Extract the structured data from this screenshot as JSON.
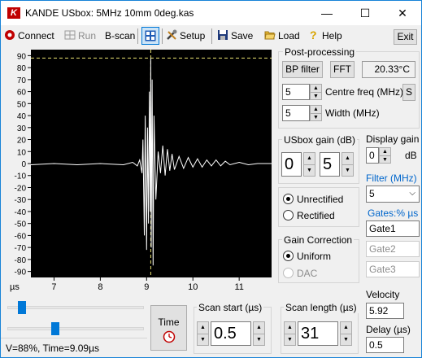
{
  "window": {
    "app_icon": "K",
    "title": "KANDE USbox: 5MHz 10mm 0deg.kas",
    "minimize": "—",
    "maximize": "☐",
    "close": "✕"
  },
  "toolbar": {
    "connect": "Connect",
    "run": "Run",
    "bscan": "B-scan",
    "setup": "Setup",
    "save": "Save",
    "load": "Load",
    "help": "Help",
    "exit": "Exit"
  },
  "plot": {
    "y_ticks": [
      "90",
      "80",
      "70",
      "60",
      "50",
      "40",
      "30",
      "20",
      "10",
      "0",
      "-10",
      "-20",
      "-30",
      "-40",
      "-50",
      "-60",
      "-70",
      "-80",
      "-90"
    ],
    "x_ticks": [
      "7",
      "8",
      "9",
      "10",
      "11"
    ],
    "x_unit": "µs"
  },
  "chart_data": {
    "type": "line",
    "x_unit": "µs",
    "xlim": [
      6.5,
      11.7
    ],
    "ylim": [
      -95,
      95
    ],
    "y_ticks": [
      90,
      80,
      70,
      60,
      50,
      40,
      30,
      20,
      10,
      0,
      -10,
      -20,
      -30,
      -40,
      -50,
      -60,
      -70,
      -80,
      -90
    ],
    "x_ticks": [
      7,
      8,
      9,
      10,
      11
    ],
    "gate_y": 88,
    "cursor_x": 9.09,
    "series": [
      {
        "x": [
          6.5,
          7.0,
          7.5,
          8.0,
          8.5,
          8.7,
          8.8,
          8.85,
          8.9,
          8.92,
          8.95,
          8.97,
          9.0,
          9.02,
          9.04,
          9.06,
          9.08,
          9.09,
          9.1,
          9.12,
          9.14,
          9.16,
          9.2,
          9.25,
          9.3,
          9.35,
          9.4,
          9.45,
          9.5,
          9.55,
          9.6,
          9.7,
          9.8,
          9.9,
          10.0,
          10.1,
          10.2,
          10.3,
          10.4,
          10.5,
          10.6,
          10.7,
          10.8,
          11.0,
          11.2,
          11.4,
          11.7
        ],
        "y": [
          -1,
          0,
          -1,
          0,
          -1,
          1,
          -2,
          3,
          -8,
          20,
          -60,
          40,
          -72,
          30,
          -50,
          60,
          -40,
          88,
          -70,
          70,
          -85,
          40,
          -30,
          10,
          -8,
          15,
          -10,
          12,
          -6,
          8,
          -5,
          6,
          -4,
          5,
          -3,
          4,
          -3,
          3,
          -2,
          3,
          -2,
          2,
          -1,
          1,
          -1,
          0,
          0
        ]
      }
    ]
  },
  "post": {
    "title": "Post-processing",
    "bp_filter": "BP filter",
    "fft": "FFT",
    "temp": "20.33°C",
    "centre_val": "5",
    "centre_label": "Centre freq (MHz)",
    "s_btn": "S",
    "width_val": "5",
    "width_label": "Width (MHz)"
  },
  "usgain": {
    "title": "USbox gain (dB)",
    "tens": "0",
    "units": "5"
  },
  "display_gain": {
    "label": "Display gain",
    "value": "0",
    "unit": "dB"
  },
  "filter": {
    "label": "Filter (MHz)",
    "value": "5"
  },
  "rect": {
    "unrectified": "Unrectified",
    "rectified": "Rectified"
  },
  "gates": {
    "label": "Gates:% µs",
    "g1": "Gate1",
    "g2": "Gate2",
    "g3": "Gate3"
  },
  "gain_corr": {
    "title": "Gain Correction",
    "uniform": "Uniform",
    "dac": "DAC"
  },
  "scan_start": {
    "title": "Scan start (µs)",
    "value": "0.5"
  },
  "scan_length": {
    "title": "Scan length (µs)",
    "value": "31"
  },
  "time_btn": "Time",
  "velocity": {
    "label": "Velocity",
    "value": "5.92"
  },
  "delay": {
    "label": "Delay (µs)",
    "value": "0.5"
  },
  "sliders": {
    "top": 0.08,
    "bottom": 0.34
  },
  "status": "V=88%, Time=9.09µs",
  "colors": {
    "trace": "#ffffff",
    "gate_line": "#e8e070",
    "filter_label": "#0066cc",
    "connect_icon": "#c00000"
  }
}
